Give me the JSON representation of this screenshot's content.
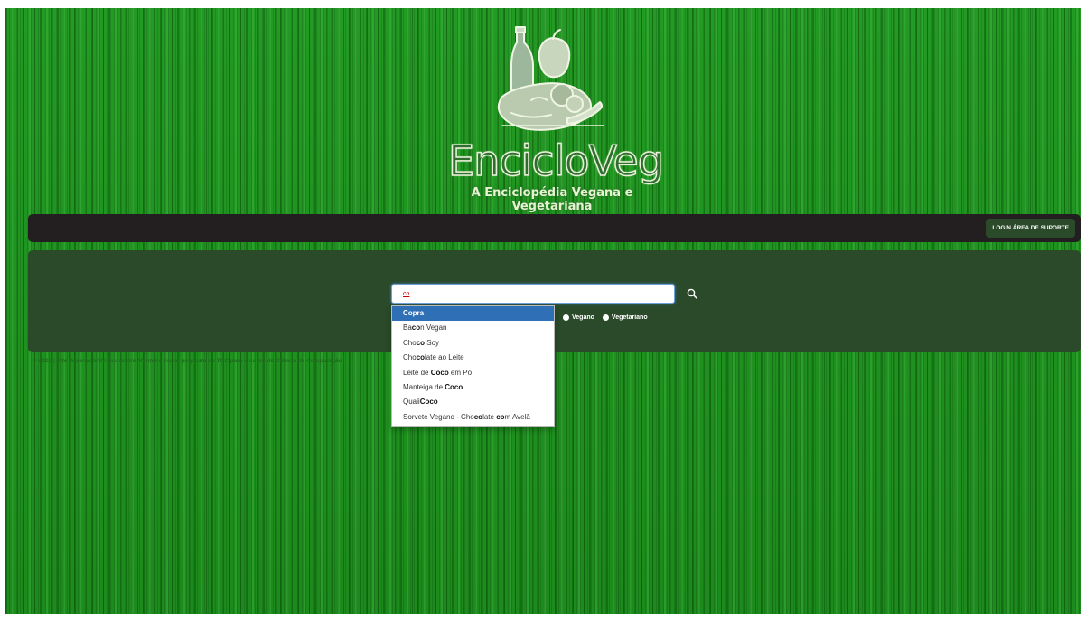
{
  "brand": {
    "name": "EncicloVeg",
    "tagline": "A Enciclopédia Vegana e Vegetariana"
  },
  "navbar": {
    "login_label": "LOGIN ÁREA DE SUPORTE"
  },
  "search": {
    "value": "co",
    "options": [
      {
        "label": "Vegano"
      },
      {
        "label": "Vegetariano"
      }
    ]
  },
  "autocomplete": {
    "items": [
      {
        "parts": [
          {
            "t": "Co",
            "b": true
          },
          {
            "t": "pra",
            "b": true
          }
        ],
        "active": true
      },
      {
        "parts": [
          {
            "t": "Ba",
            "b": false
          },
          {
            "t": "co",
            "b": true
          },
          {
            "t": "n Vegan",
            "b": false
          }
        ]
      },
      {
        "parts": [
          {
            "t": "Cho",
            "b": false
          },
          {
            "t": "co",
            "b": true
          },
          {
            "t": " Soy",
            "b": false
          }
        ]
      },
      {
        "parts": [
          {
            "t": "Cho",
            "b": false
          },
          {
            "t": "co",
            "b": true
          },
          {
            "t": "late ao Leite",
            "b": false
          }
        ]
      },
      {
        "parts": [
          {
            "t": "Leite de ",
            "b": false
          },
          {
            "t": "Coco",
            "b": true
          },
          {
            "t": " em Pó",
            "b": false
          }
        ]
      },
      {
        "parts": [
          {
            "t": "Manteiga de ",
            "b": false
          },
          {
            "t": "Coco",
            "b": true
          }
        ]
      },
      {
        "parts": [
          {
            "t": "Quali",
            "b": false
          },
          {
            "t": "Coco",
            "b": true
          }
        ]
      },
      {
        "parts": [
          {
            "t": "Sorvete Vegano - Cho",
            "b": false
          },
          {
            "t": "co",
            "b": true
          },
          {
            "t": "late ",
            "b": false
          },
          {
            "t": "co",
            "b": true
          },
          {
            "t": "m Avelã",
            "b": false
          }
        ]
      }
    ]
  },
  "footer": {
    "text": "© 2022 | Site desenvolvido por André Monteiro como proposta de TCC para o curso de Ciência da Computação"
  },
  "colors": {
    "background": "#1f8f1f",
    "navbar": "#231f20",
    "panel": "#2a4a2a",
    "active_item": "#2f6fb5"
  },
  "icons": [
    "logo-illustration",
    "search-icon"
  ]
}
